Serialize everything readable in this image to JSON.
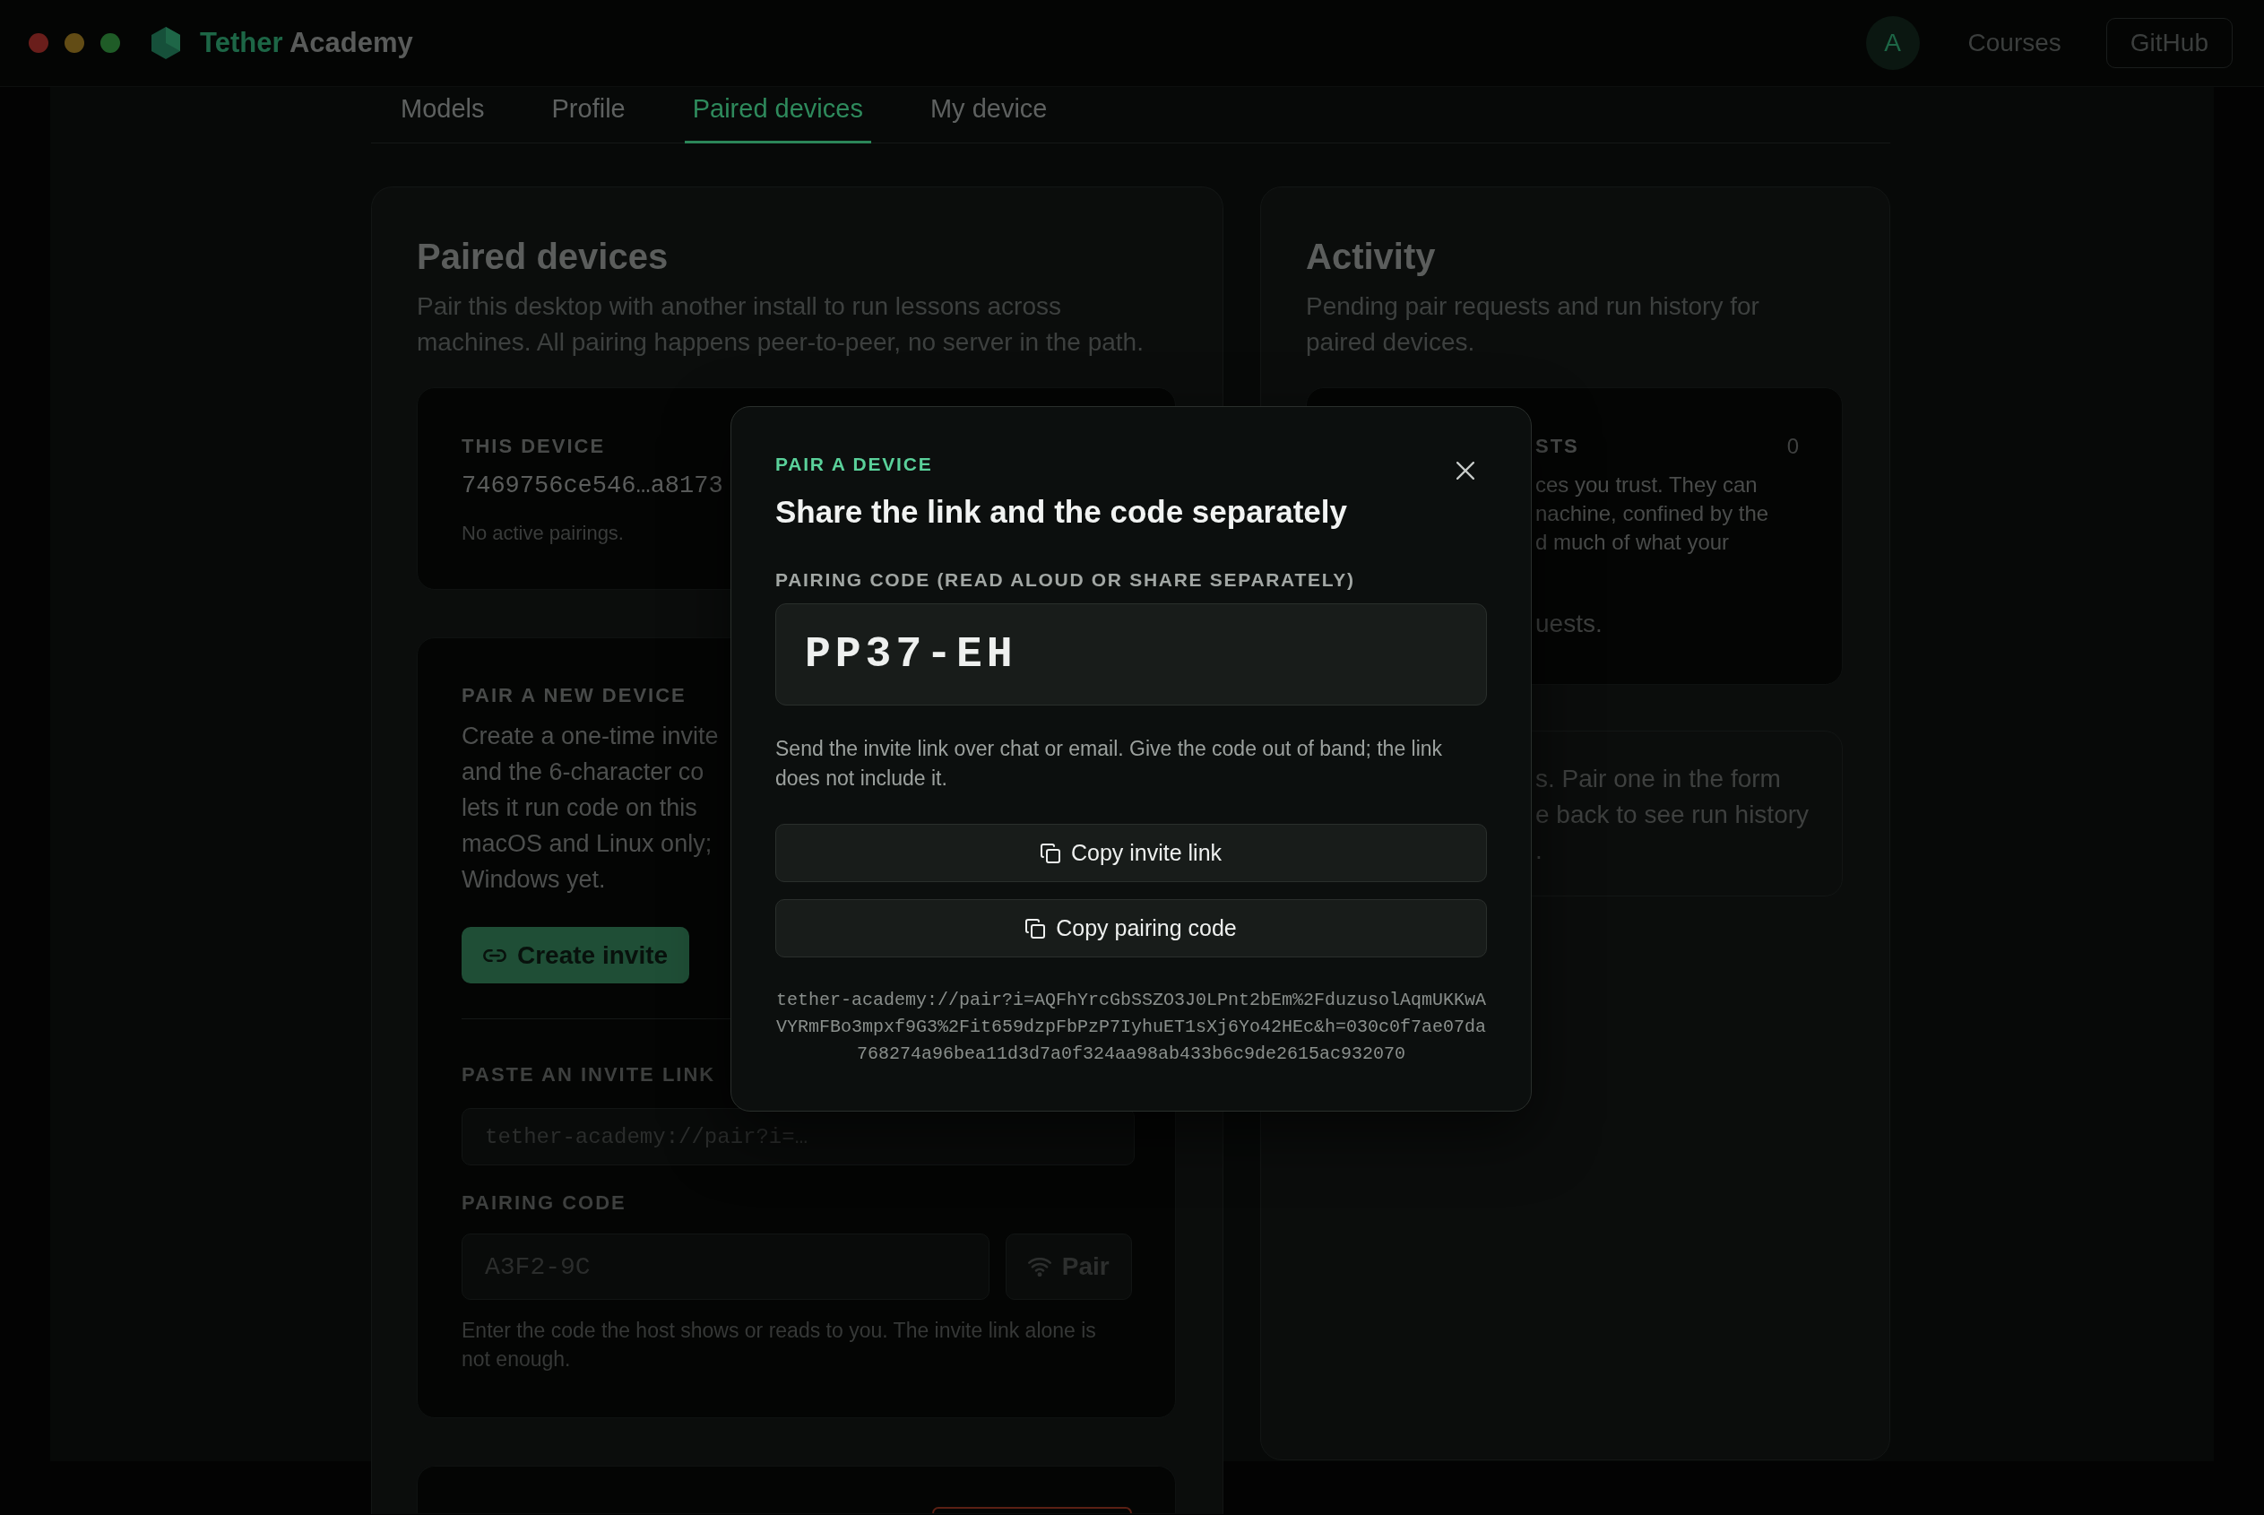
{
  "window_controls": [
    {
      "kind": "close"
    },
    {
      "kind": "minimize"
    },
    {
      "kind": "zoom"
    }
  ],
  "header": {
    "brand": {
      "accent": "Tether",
      "rest": "Academy"
    },
    "avatar": "A",
    "nav_link": "Courses",
    "github_button": "GitHub"
  },
  "tabs": [
    {
      "label": "Models",
      "selected": false
    },
    {
      "label": "Profile",
      "selected": false
    },
    {
      "label": "Paired devices",
      "selected": true
    },
    {
      "label": "My device",
      "selected": false
    }
  ],
  "paired_devices": {
    "title": "Paired devices",
    "description": "Pair this desktop with another install to run lessons across machines. All pairing happens peer-to-peer, no server in the path.",
    "this_device": {
      "label": "THIS DEVICE",
      "device_id": "7469756ce546…a8173",
      "status": "No active pairings."
    },
    "pair_new_device": {
      "label": "PAIR A NEW DEVICE",
      "description_lines": [
        "Create a one-time invite",
        "and the 6-character co",
        "lets it run code on this",
        "macOS and Linux only;",
        "Windows yet."
      ],
      "create_button": "Create invite",
      "invite_link_label": "PASTE AN INVITE LINK",
      "invite_link_field": {
        "placeholder": "tether-academy://pair?i=…"
      },
      "code_label": "PAIRING CODE",
      "code_field": {
        "placeholder": "A3F2-9C"
      },
      "pair_button": "Pair",
      "hint": "Enter the code the host shows or reads to you. The invite link alone is not enough."
    }
  },
  "activity": {
    "title": "Activity",
    "description": "Pending pair requests and run history for paired devices.",
    "requests_panel": {
      "label": "STS",
      "count": "0",
      "text_lines": [
        "ces you trust. They can",
        "nachine, confined by the",
        "d much of what your"
      ],
      "empty_text": "uests."
    },
    "history_panel": {
      "text_lines": [
        "s. Pair one in the form",
        "e back to see run history",
        "."
      ]
    }
  },
  "dialog": {
    "eyebrow": "PAIR A DEVICE",
    "title": "Share the link and the code separately",
    "code_label": "PAIRING CODE (READ ALOUD OR SHARE SEPARATELY)",
    "code": "PP37-EH",
    "description": "Send the invite link over chat or email. Give the code out of band; the link does not include it.",
    "buttons": [
      "Copy invite link",
      "Copy pairing code"
    ],
    "invite_link": "tether-academy://pair?i=AQFhYrcGbSSZO3J0LPnt2bEm%2FduzusolAqmUKKwAVYRmFBo3mpxf9G3%2Fit659dzpFbPzP7IyhuET1sXj6Yo42HEc&h=030c0f7ae07da768274a96bea11d3d7a0f324aa98ab433b6c9de2615ac932070"
  }
}
